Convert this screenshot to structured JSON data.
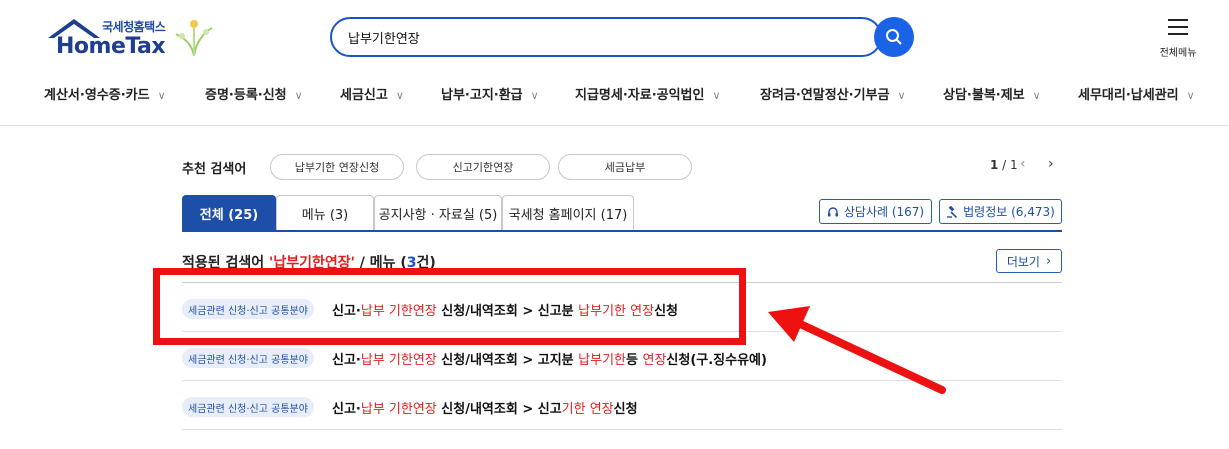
{
  "logo": {
    "small": "국세청홈택스",
    "main": "HomeTax"
  },
  "search": {
    "value": "납부기한연장",
    "placeholder": ""
  },
  "header": {
    "all_menu_label": "전체메뉴"
  },
  "gnb": [
    "계산서·영수증·카드",
    "증명·등록·신청",
    "세금신고",
    "납부·고지·환급",
    "지급명세·자료·공익법인",
    "장려금·연말정산·기부금",
    "상담·불복·제보",
    "세무대리·납세관리"
  ],
  "recommend": {
    "title": "추천 검색어",
    "chips": [
      "납부기한 연장신청",
      "신고기한연장",
      "세금납부"
    ],
    "page_current": "1",
    "page_sep": " / ",
    "page_total": "1"
  },
  "tabs": [
    "전체 (25)",
    "메뉴 (3)",
    "공지사항 · 자료실 (5)",
    "국세청 홈페이지 (17)"
  ],
  "right_buttons": [
    "상담사례 (167)",
    "법령정보 (6,473)"
  ],
  "result": {
    "title_prefix": "적용된 검색어 ",
    "keyword": "'납부기한연장'",
    "title_mid": " / 메뉴 (",
    "count": "3",
    "title_suffix": "건)",
    "more_label": "더보기"
  },
  "rows": [
    {
      "badge": "세금관련 신청·신고 공통분야",
      "parts": [
        {
          "t": "신고·",
          "h": false
        },
        {
          "t": "납부 기한연장",
          "h": true
        },
        {
          "t": " 신청/내역조회 > 신고분 ",
          "h": false
        },
        {
          "t": "납부기한 연장",
          "h": true
        },
        {
          "t": "신청",
          "h": false
        }
      ]
    },
    {
      "badge": "세금관련 신청·신고 공통분야",
      "parts": [
        {
          "t": "신고·",
          "h": false
        },
        {
          "t": "납부 기한연장",
          "h": true
        },
        {
          "t": " 신청/내역조회 > 고지분 ",
          "h": false
        },
        {
          "t": "납부기한",
          "h": true
        },
        {
          "t": "등 ",
          "h": false
        },
        {
          "t": "연장",
          "h": true
        },
        {
          "t": "신청(구.징수유예)",
          "h": false
        }
      ]
    },
    {
      "badge": "세금관련 신청·신고 공통분야",
      "parts": [
        {
          "t": "신고·",
          "h": false
        },
        {
          "t": "납부 기한연장",
          "h": true
        },
        {
          "t": " 신청/내역조회 > 신고",
          "h": false
        },
        {
          "t": "기한 연장",
          "h": true
        },
        {
          "t": "신청",
          "h": false
        }
      ]
    }
  ],
  "colors": {
    "brand": "#1e4fa8",
    "highlight": "#e02020",
    "annotation": "#ee1111"
  }
}
